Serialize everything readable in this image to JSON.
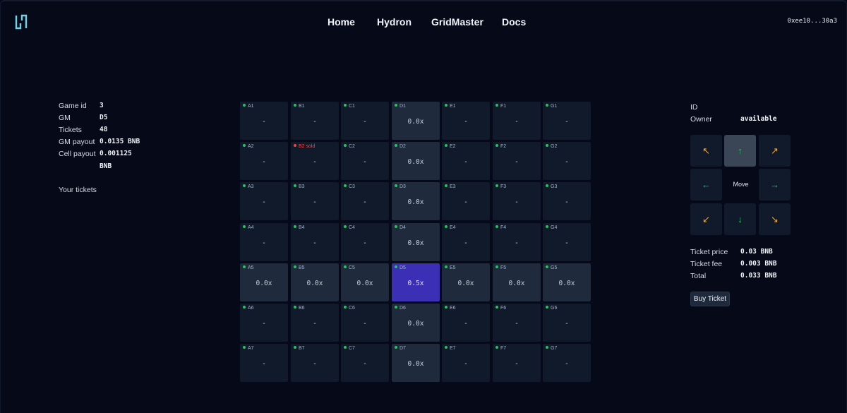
{
  "nav": {
    "links": [
      "Home",
      "Hydron",
      "GridMaster",
      "Docs"
    ],
    "wallet": "0xee10...30a3"
  },
  "game_info": {
    "rows": [
      {
        "label": "Game id",
        "value": "3"
      },
      {
        "label": "GM",
        "value": "D5"
      },
      {
        "label": "Tickets",
        "value": "48"
      },
      {
        "label": "GM payout",
        "value": "0.0135 BNB"
      },
      {
        "label": "Cell payout",
        "value": "0.001125"
      }
    ],
    "cell_payout_unit": "BNB",
    "your_tickets_label": "Your tickets"
  },
  "grid": {
    "columns": [
      "A",
      "B",
      "C",
      "D",
      "E",
      "F",
      "G"
    ],
    "rows": [
      [
        {
          "label": "A1",
          "value": "-"
        },
        {
          "label": "B1",
          "value": "-"
        },
        {
          "label": "C1",
          "value": "-"
        },
        {
          "label": "D1",
          "value": "0.0x"
        },
        {
          "label": "E1",
          "value": "-"
        },
        {
          "label": "F1",
          "value": "-"
        },
        {
          "label": "G1",
          "value": "-"
        }
      ],
      [
        {
          "label": "A2",
          "value": "-"
        },
        {
          "label": "B2 sold",
          "value": "-",
          "sold": true
        },
        {
          "label": "C2",
          "value": "-"
        },
        {
          "label": "D2",
          "value": "0.0x"
        },
        {
          "label": "E2",
          "value": "-"
        },
        {
          "label": "F2",
          "value": "-"
        },
        {
          "label": "G2",
          "value": "-"
        }
      ],
      [
        {
          "label": "A3",
          "value": "-"
        },
        {
          "label": "B3",
          "value": "-"
        },
        {
          "label": "C3",
          "value": "-"
        },
        {
          "label": "D3",
          "value": "0.0x"
        },
        {
          "label": "E3",
          "value": "-"
        },
        {
          "label": "F3",
          "value": "-"
        },
        {
          "label": "G3",
          "value": "-"
        }
      ],
      [
        {
          "label": "A4",
          "value": "-"
        },
        {
          "label": "B4",
          "value": "-"
        },
        {
          "label": "C4",
          "value": "-"
        },
        {
          "label": "D4",
          "value": "0.0x"
        },
        {
          "label": "E4",
          "value": "-"
        },
        {
          "label": "F4",
          "value": "-"
        },
        {
          "label": "G4",
          "value": "-"
        }
      ],
      [
        {
          "label": "A5",
          "value": "0.0x"
        },
        {
          "label": "B5",
          "value": "0.0x"
        },
        {
          "label": "C5",
          "value": "0.0x"
        },
        {
          "label": "D5",
          "value": "0.5x",
          "selected": true
        },
        {
          "label": "E5",
          "value": "0.0x"
        },
        {
          "label": "F5",
          "value": "0.0x"
        },
        {
          "label": "G5",
          "value": "0.0x"
        }
      ],
      [
        {
          "label": "A6",
          "value": "-"
        },
        {
          "label": "B6",
          "value": "-"
        },
        {
          "label": "C6",
          "value": "-"
        },
        {
          "label": "D6",
          "value": "0.0x"
        },
        {
          "label": "E6",
          "value": "-"
        },
        {
          "label": "F6",
          "value": "-"
        },
        {
          "label": "G6",
          "value": "-"
        }
      ],
      [
        {
          "label": "A7",
          "value": "-"
        },
        {
          "label": "B7",
          "value": "-"
        },
        {
          "label": "C7",
          "value": "-"
        },
        {
          "label": "D7",
          "value": "0.0x"
        },
        {
          "label": "E7",
          "value": "-"
        },
        {
          "label": "F7",
          "value": "-"
        },
        {
          "label": "G7",
          "value": "-"
        }
      ]
    ]
  },
  "cell_panel": {
    "id_label": "ID",
    "owner_label": "Owner",
    "owner_value": "available"
  },
  "move_pad": {
    "center_label": "Move",
    "buttons": [
      {
        "name": "move-up-left-button",
        "glyph": "↖",
        "kind": "diag"
      },
      {
        "name": "move-up-button",
        "glyph": "↑",
        "kind": "orth",
        "active": true
      },
      {
        "name": "move-up-right-button",
        "glyph": "↗",
        "kind": "diag"
      },
      {
        "name": "move-left-button",
        "glyph": "←",
        "kind": "orth"
      },
      {
        "name": "move-right-button",
        "glyph": "→",
        "kind": "orth"
      },
      {
        "name": "move-down-left-button",
        "glyph": "↙",
        "kind": "diag"
      },
      {
        "name": "move-down-button",
        "glyph": "↓",
        "kind": "orth"
      },
      {
        "name": "move-down-right-button",
        "glyph": "↘",
        "kind": "diag"
      }
    ]
  },
  "pricing": {
    "rows": [
      {
        "label": "Ticket price",
        "value": "0.03 BNB"
      },
      {
        "label": "Ticket fee",
        "value": "0.003 BNB"
      },
      {
        "label": "Total",
        "value": "0.033 BNB"
      }
    ],
    "buy_label": "Buy Ticket"
  },
  "colors": {
    "background": "#060a18",
    "cell": "#111a2b",
    "cell_highlight": "#1f2a3c",
    "cell_selected": "#3b2fb6",
    "available_dot": "#22c55e",
    "sold": "#ef4444",
    "diag_arrow": "#f5a623",
    "logo": "#6fd3e6"
  }
}
